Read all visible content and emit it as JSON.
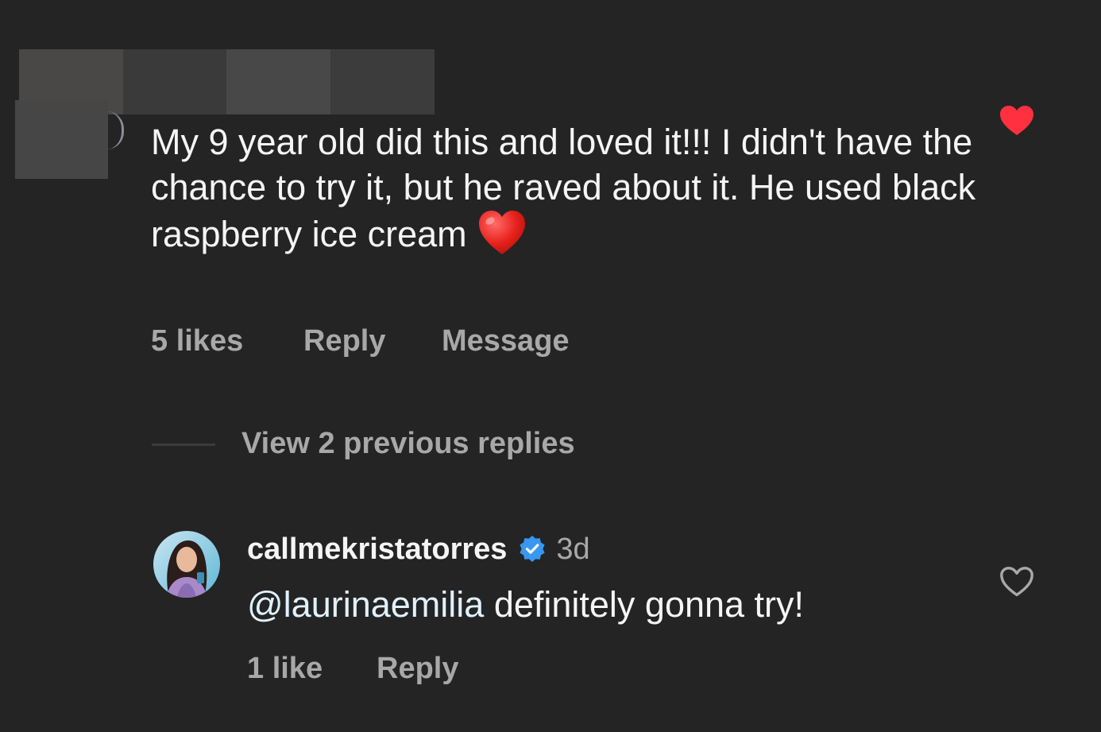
{
  "comment": {
    "text": "My 9 year old did this and loved it!!! I didn't have the chance to try it, but he raved about it. He used black raspberry ice cream",
    "emoji": "red-heart-emoji",
    "likes": "5 likes",
    "reply_label": "Reply",
    "message_label": "Message",
    "liked": true
  },
  "thread": {
    "view_replies_label": "View 2 previous replies"
  },
  "reply": {
    "username": "callmekristatorres",
    "verified": true,
    "timestamp": "3d",
    "mention": "@laurinaemilia",
    "text": " definitely gonna try!",
    "likes": "1 like",
    "reply_label": "Reply",
    "liked": false
  },
  "colors": {
    "background": "#242424",
    "primary_text": "#f5f5f5",
    "secondary_text": "#a8a8a8",
    "like_red": "#ff3040",
    "verified_blue": "#3897f0",
    "mention": "#e0f1ff"
  },
  "icons": {
    "liked": "filled-heart-icon",
    "unliked": "outline-heart-icon",
    "verified": "verified-badge-icon"
  }
}
